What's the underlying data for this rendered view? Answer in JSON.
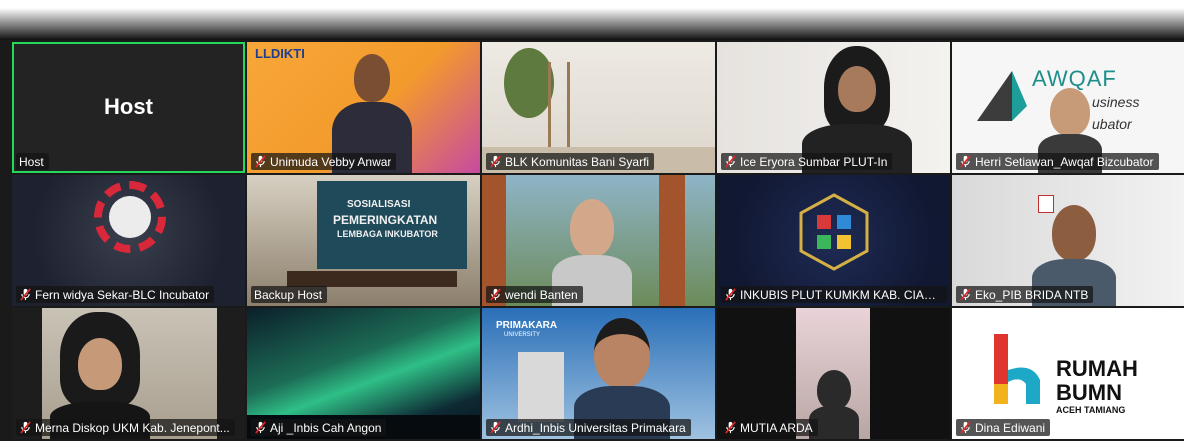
{
  "host_tile_text": "Host",
  "participants": [
    {
      "name": "Host",
      "muted": false
    },
    {
      "name": "Unimuda Vebby Anwar",
      "muted": true
    },
    {
      "name": "BLK Komunitas Bani Syarfi",
      "muted": true
    },
    {
      "name": "Ice Eryora Sumbar PLUT-In",
      "muted": true
    },
    {
      "name": "Herri Setiawan_Awqaf Bizcubator",
      "muted": true
    },
    {
      "name": "Fern widya Sekar-BLC Incubator",
      "muted": true
    },
    {
      "name": "Backup Host",
      "muted": false
    },
    {
      "name": "wendi Banten",
      "muted": true
    },
    {
      "name": "INKUBIS PLUT KUMKM KAB. CIAN...",
      "muted": true
    },
    {
      "name": "Eko_PIB BRIDA NTB",
      "muted": true
    },
    {
      "name": "Merna Diskop UKM Kab. Jenepont...",
      "muted": true
    },
    {
      "name": "Aji _Inbis Cah Angon",
      "muted": true
    },
    {
      "name": "Ardhi_Inbis Universitas Primakara",
      "muted": true
    },
    {
      "name": "MUTIA ARDA",
      "muted": true
    },
    {
      "name": "Dina Ediwani",
      "muted": true
    }
  ],
  "backgrounds": {
    "awqaf_brand": "AWQAF",
    "awqaf_line2": "usiness",
    "awqaf_line3": "ubator",
    "llbkti_brand": "LLDIKTI",
    "banner_line1": "SOSIALISASI",
    "banner_line2": "PEMERINGKATAN",
    "banner_line3": "LEMBAGA INKUBATOR",
    "primakara_brand": "PRIMAKARA",
    "primakara_sub": "UNIVERSITY",
    "rumah_line1": "RUMAH",
    "rumah_line2": "BUMN",
    "rumah_line3": "ACEH TAMIANG"
  },
  "colors": {
    "active_speaker_border": "#23d959",
    "muted_icon": "#e02828",
    "tile_bg": "#232323"
  }
}
